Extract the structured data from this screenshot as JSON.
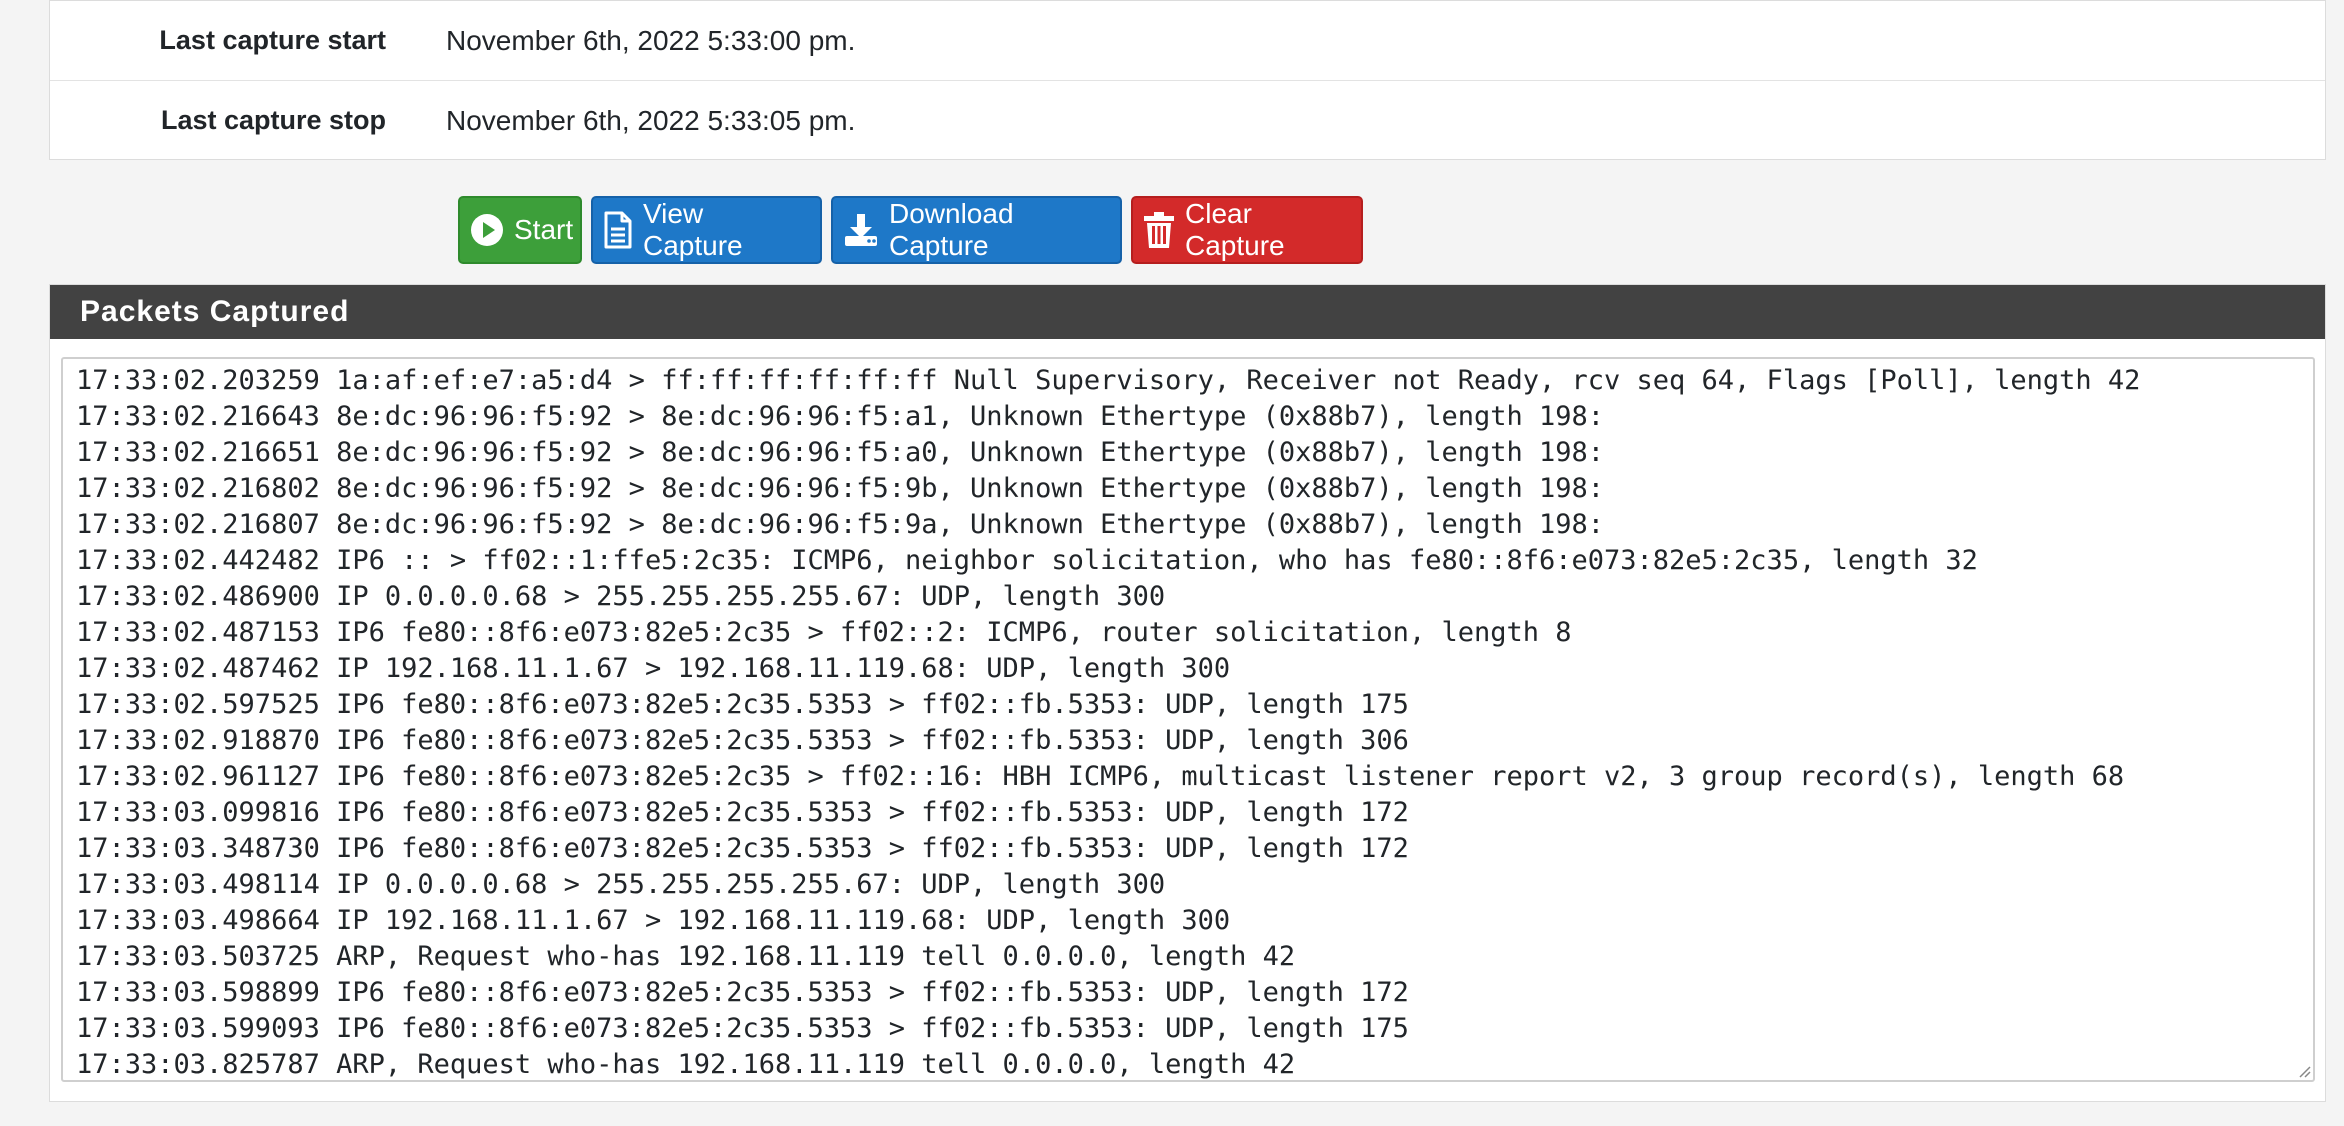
{
  "capture_info": {
    "start_label": "Last capture start",
    "start_value": "November 6th, 2022 5:33:00 pm.",
    "stop_label": "Last capture stop",
    "stop_value": "November 6th, 2022 5:33:05 pm."
  },
  "buttons": {
    "start": {
      "label": "Start",
      "icon": "play-circle-icon",
      "color": "#3d9f3a"
    },
    "view": {
      "label": "View Capture",
      "icon": "document-icon",
      "color": "#1e78c8"
    },
    "download": {
      "label": "Download Capture",
      "icon": "download-icon",
      "color": "#1e78c8"
    },
    "clear": {
      "label": "Clear Capture",
      "icon": "trash-icon",
      "color": "#d32a2a"
    }
  },
  "packets_panel": {
    "title": "Packets Captured",
    "lines": [
      "17:33:02.203259 1a:af:ef:e7:a5:d4 > ff:ff:ff:ff:ff:ff Null Supervisory, Receiver not Ready, rcv seq 64, Flags [Poll], length 42",
      "17:33:02.216643 8e:dc:96:96:f5:92 > 8e:dc:96:96:f5:a1, Unknown Ethertype (0x88b7), length 198:",
      "17:33:02.216651 8e:dc:96:96:f5:92 > 8e:dc:96:96:f5:a0, Unknown Ethertype (0x88b7), length 198:",
      "17:33:02.216802 8e:dc:96:96:f5:92 > 8e:dc:96:96:f5:9b, Unknown Ethertype (0x88b7), length 198:",
      "17:33:02.216807 8e:dc:96:96:f5:92 > 8e:dc:96:96:f5:9a, Unknown Ethertype (0x88b7), length 198:",
      "17:33:02.442482 IP6 :: > ff02::1:ffe5:2c35: ICMP6, neighbor solicitation, who has fe80::8f6:e073:82e5:2c35, length 32",
      "17:33:02.486900 IP 0.0.0.0.68 > 255.255.255.255.67: UDP, length 300",
      "17:33:02.487153 IP6 fe80::8f6:e073:82e5:2c35 > ff02::2: ICMP6, router solicitation, length 8",
      "17:33:02.487462 IP 192.168.11.1.67 > 192.168.11.119.68: UDP, length 300",
      "17:33:02.597525 IP6 fe80::8f6:e073:82e5:2c35.5353 > ff02::fb.5353: UDP, length 175",
      "17:33:02.918870 IP6 fe80::8f6:e073:82e5:2c35.5353 > ff02::fb.5353: UDP, length 306",
      "17:33:02.961127 IP6 fe80::8f6:e073:82e5:2c35 > ff02::16: HBH ICMP6, multicast listener report v2, 3 group record(s), length 68",
      "17:33:03.099816 IP6 fe80::8f6:e073:82e5:2c35.5353 > ff02::fb.5353: UDP, length 172",
      "17:33:03.348730 IP6 fe80::8f6:e073:82e5:2c35.5353 > ff02::fb.5353: UDP, length 172",
      "17:33:03.498114 IP 0.0.0.0.68 > 255.255.255.255.67: UDP, length 300",
      "17:33:03.498664 IP 192.168.11.1.67 > 192.168.11.119.68: UDP, length 300",
      "17:33:03.503725 ARP, Request who-has 192.168.11.119 tell 0.0.0.0, length 42",
      "17:33:03.598899 IP6 fe80::8f6:e073:82e5:2c35.5353 > ff02::fb.5353: UDP, length 172",
      "17:33:03.599093 IP6 fe80::8f6:e073:82e5:2c35.5353 > ff02::fb.5353: UDP, length 175",
      "17:33:03.825787 ARP, Request who-has 192.168.11.119 tell 0.0.0.0, length 42"
    ]
  }
}
